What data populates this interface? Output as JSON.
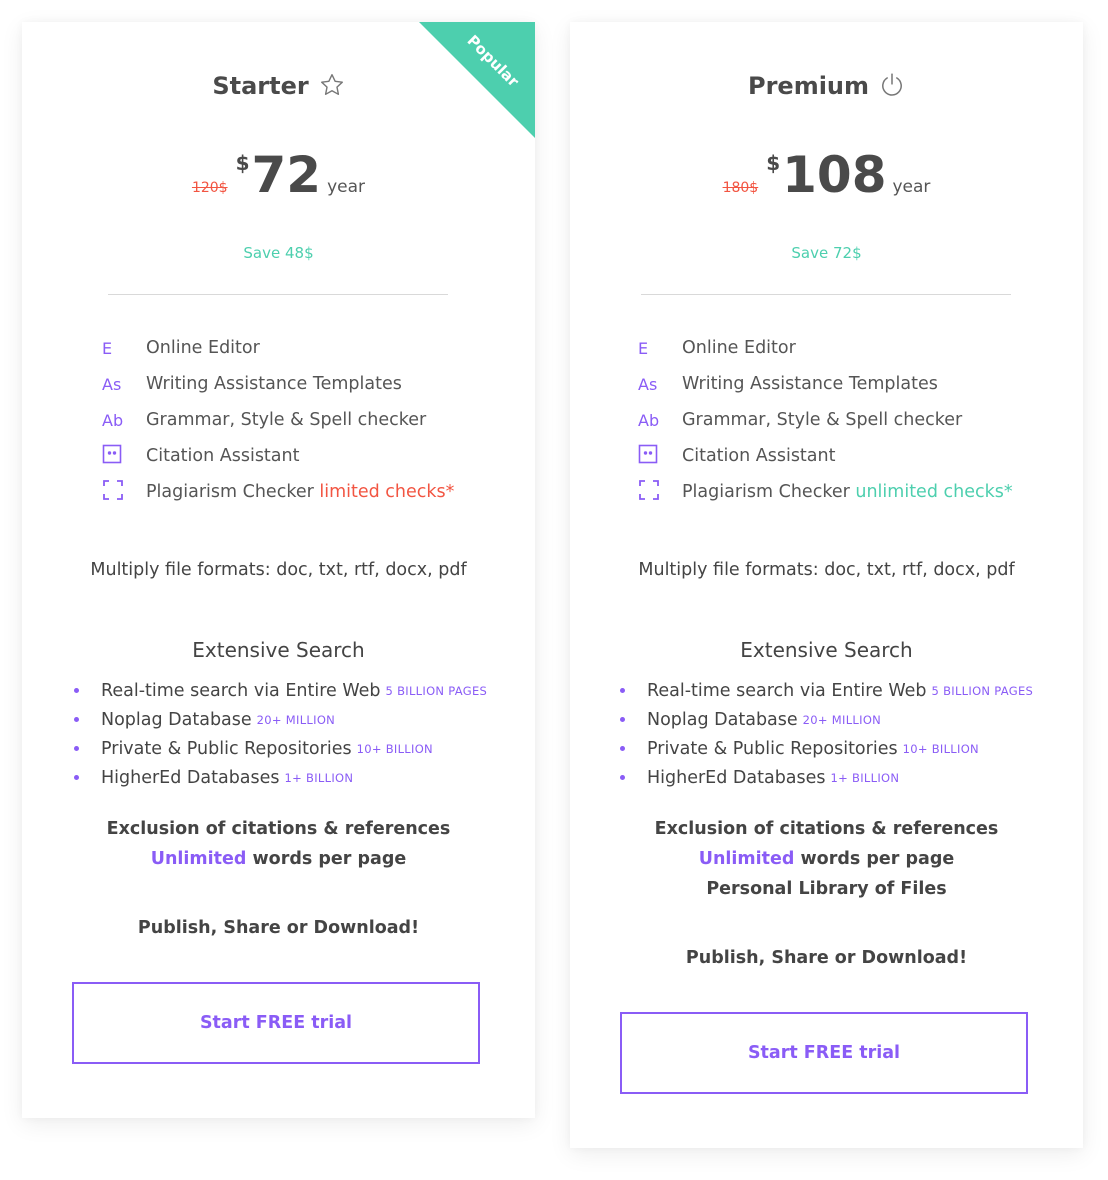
{
  "colors": {
    "accent": "#8a5cf6",
    "success": "#4dcfae",
    "danger": "#f25542",
    "text": "#4a4a4a"
  },
  "plans": [
    {
      "name": "Starter",
      "icon": "star-icon",
      "badge": "Popular",
      "old_price": "120$",
      "currency": "$",
      "price": "72",
      "period": "year",
      "save": "Save 48$",
      "features": [
        {
          "icon": "editor-icon",
          "glyph": "E",
          "label": "Online Editor"
        },
        {
          "icon": "templates-icon",
          "glyph": "As",
          "label": "Writing Assistance Templates"
        },
        {
          "icon": "grammar-icon",
          "glyph": "Ab",
          "label": "Grammar, Style & Spell checker"
        },
        {
          "icon": "citation-icon",
          "glyph": "",
          "label": "Citation Assistant"
        },
        {
          "icon": "plagiarism-icon",
          "glyph": "",
          "label": "Plagiarism Checker",
          "note": "limited checks*"
        }
      ],
      "formats": "Multiply file formats: doc, txt, rtf, docx, pdf",
      "search_title": "Extensive Search",
      "search_items": [
        {
          "label": "Real-time search via Entire Web",
          "tag": "5 BILLION PAGES"
        },
        {
          "label": "Noplag Database",
          "tag": "20+ MILLION"
        },
        {
          "label": "Private & Public Repositories",
          "tag": "10+ BILLION"
        },
        {
          "label": "HigherEd Databases",
          "tag": "1+ BILLION"
        }
      ],
      "extras": {
        "exclusion": "Exclusion of citations & references",
        "unlimited": "Unlimited",
        "words": " words per page"
      },
      "publish": "Publish, Share or Download!",
      "cta": "Start FREE trial"
    },
    {
      "name": "Premium",
      "icon": "power-icon",
      "old_price": "180$",
      "currency": "$",
      "price": "108",
      "period": "year",
      "save": "Save 72$",
      "features": [
        {
          "icon": "editor-icon",
          "glyph": "E",
          "label": "Online Editor"
        },
        {
          "icon": "templates-icon",
          "glyph": "As",
          "label": "Writing Assistance Templates"
        },
        {
          "icon": "grammar-icon",
          "glyph": "Ab",
          "label": "Grammar, Style & Spell checker"
        },
        {
          "icon": "citation-icon",
          "glyph": "",
          "label": "Citation Assistant"
        },
        {
          "icon": "plagiarism-icon",
          "glyph": "",
          "label": "Plagiarism Checker",
          "note": "unlimited checks*"
        }
      ],
      "formats": "Multiply file formats: doc, txt, rtf, docx, pdf",
      "search_title": "Extensive Search",
      "search_items": [
        {
          "label": "Real-time search via Entire Web",
          "tag": "5 BILLION PAGES"
        },
        {
          "label": "Noplag Database",
          "tag": "20+ MILLION"
        },
        {
          "label": "Private & Public Repositories",
          "tag": "10+ BILLION"
        },
        {
          "label": "HigherEd Databases",
          "tag": "1+ BILLION"
        }
      ],
      "extras": {
        "exclusion": "Exclusion of citations & references",
        "unlimited": "Unlimited",
        "words": " words per page",
        "library": "Personal Library of Files"
      },
      "publish": "Publish, Share or Download!",
      "cta": "Start FREE trial"
    }
  ]
}
